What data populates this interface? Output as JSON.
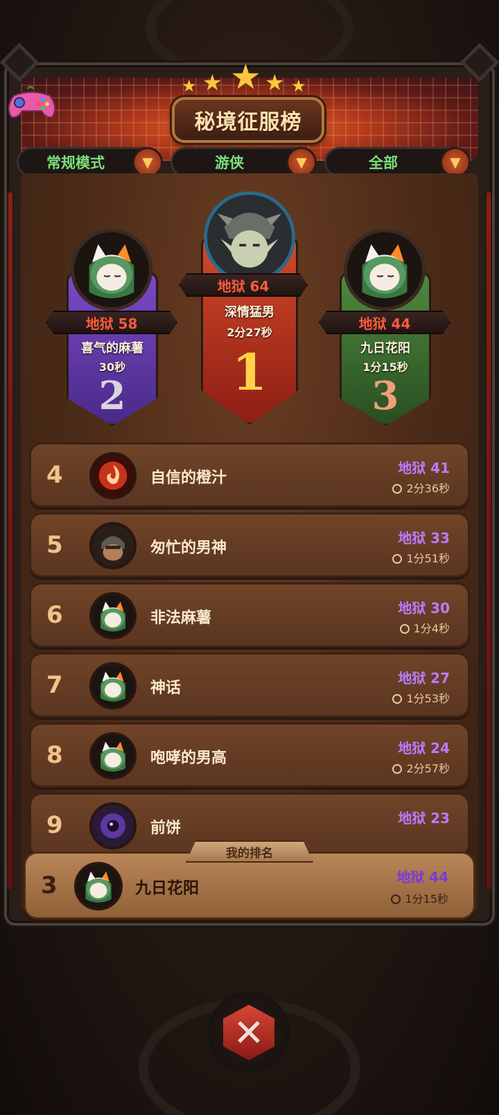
{
  "header": {
    "title": "秘境征服榜"
  },
  "filters": [
    {
      "label": "常规模式"
    },
    {
      "label": "游侠"
    },
    {
      "label": "全部"
    }
  ],
  "podium": [
    {
      "place": "2",
      "level": "地狱 58",
      "name": "喜气的麻薯",
      "time": "30秒"
    },
    {
      "place": "1",
      "level": "地狱 64",
      "name": "深情猛男",
      "time": "2分27秒"
    },
    {
      "place": "3",
      "level": "地狱 44",
      "name": "九日花阳",
      "time": "1分15秒"
    }
  ],
  "list": [
    {
      "rank": "4",
      "name": "自信的橙汁",
      "level": "地狱 41",
      "time": "2分36秒",
      "avatar": "fire"
    },
    {
      "rank": "5",
      "name": "匆忙的男神",
      "level": "地狱 33",
      "time": "1分51秒",
      "avatar": "knight"
    },
    {
      "rank": "6",
      "name": "非法麻薯",
      "level": "地狱 30",
      "time": "1分4秒",
      "avatar": "fox"
    },
    {
      "rank": "7",
      "name": "神话",
      "level": "地狱 27",
      "time": "1分53秒",
      "avatar": "fox"
    },
    {
      "rank": "8",
      "name": "咆哮的男高",
      "level": "地狱 24",
      "time": "2分57秒",
      "avatar": "fox"
    },
    {
      "rank": "9",
      "name": "前饼",
      "level": "地狱 23",
      "time": "",
      "avatar": "eye"
    }
  ],
  "my_rank": {
    "tab_label": "我的排名",
    "rank": "3",
    "name": "九日花阳",
    "level": "地狱 44",
    "time": "1分15秒"
  },
  "colors": {
    "level_purple": "#b87cff",
    "first_red": "#c63a22",
    "second_purple": "#5a3aa0",
    "third_green": "#3e6a32",
    "filter_green": "#7be07a"
  },
  "icons": {
    "filter_dropdown": "triangle-down-icon",
    "close": "crossed-swords-icon",
    "game_controller": "gamepad-icon"
  }
}
